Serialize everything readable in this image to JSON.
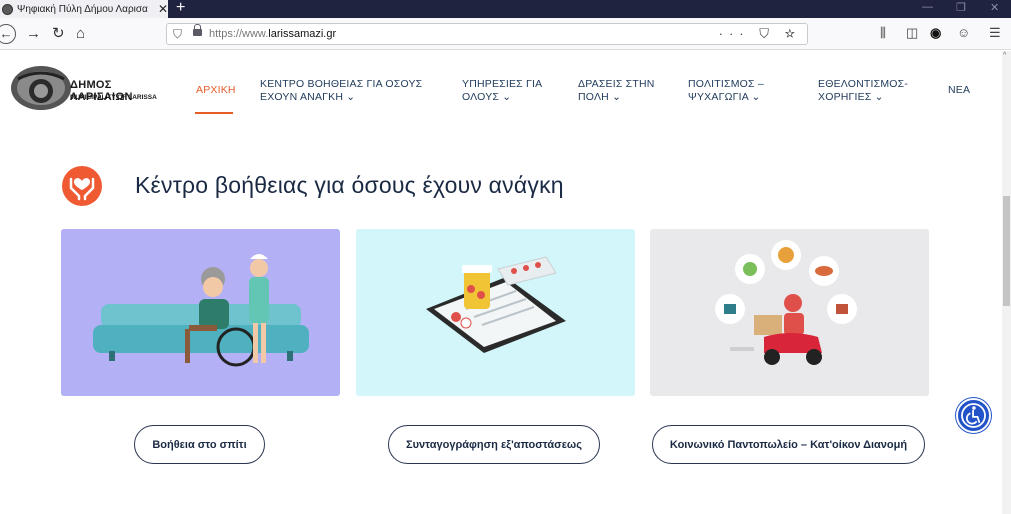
{
  "browser": {
    "tab_title": "Ψηφιακή Πύλη Δήμου Λαρισα",
    "tab_close": "✕",
    "new_tab": "+",
    "url_scheme": "https://www.",
    "url_domain": "larissamazi.gr",
    "url_actions": "··· ⛉ ☆"
  },
  "site": {
    "logo_line1": "ΔΗΜΟΣ ΛΑΡΙΣΑΙΩΝ",
    "logo_line2": "MUNICIPALITY OF LARISSA",
    "accent_color": "#e85c2a",
    "menu": [
      {
        "l1": "ΑΡΧΙΚΗ",
        "l2": ""
      },
      {
        "l1": "ΚΕΝΤΡΟ ΒΟΗΘΕΙΑΣ ΓΙΑ ΟΣΟΥΣ",
        "l2": "ΕΧΟΥΝ ΑΝΑΓΚΗ ⌄"
      },
      {
        "l1": "ΥΠΗΡΕΣΙΕΣ ΓΙΑ",
        "l2": "ΟΛΟΥΣ ⌄"
      },
      {
        "l1": "ΔΡΑΣΕΙΣ ΣΤΗΝ",
        "l2": "ΠΟΛΗ ⌄"
      },
      {
        "l1": "ΠΟΛΙΤΙΣΜΟΣ –",
        "l2": "ΨΥΧΑΓΩΓΙΑ ⌄"
      },
      {
        "l1": "ΕΘΕΛΟΝΤΙΣΜΟΣ-",
        "l2": "ΧΟΡΗΓΙΕΣ ⌄"
      },
      {
        "l1": "ΝΕΑ",
        "l2": ""
      }
    ]
  },
  "section": {
    "title": "Κέντρο βοήθειας για όσους έχουν ανάγκη",
    "cards": [
      {
        "label": "Βοήθεια στο σπίτι",
        "bg": "#b3b0f5"
      },
      {
        "label": "Συνταγογράφηση εξ'αποστάσεως",
        "bg": "#d2f6f9"
      },
      {
        "label": "Κοινωνικό Παντοπωλείο – Κατ'οίκον Διανομή",
        "bg": "#e9e9eb"
      }
    ]
  }
}
